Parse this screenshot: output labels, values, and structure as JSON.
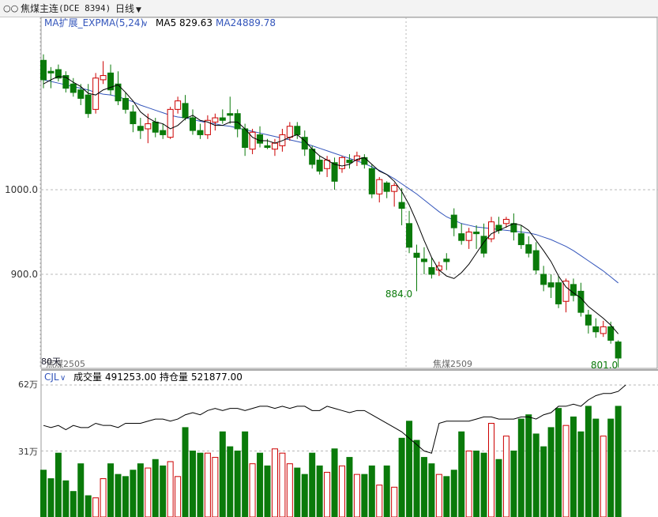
{
  "header": {
    "symbol_icon": "link-icon",
    "symbol_name": "焦煤主连",
    "symbol_code": "(DCE 8394)",
    "period": "日线"
  },
  "main_legend": {
    "indicator": "MA扩展_EXPMA(5,24)",
    "ma5_label": "MA5",
    "ma5_value": "829.63",
    "ma24_label": "MA24",
    "ma24_value": "889.78"
  },
  "vol_legend": {
    "indicator": "CJL",
    "volume_label": "成交量",
    "volume_value": "491253.00",
    "oi_label": "持仓量",
    "oi_value": "521877.00"
  },
  "markers": {
    "low_label": "884.0",
    "last_label": "801.0",
    "contract_a": "焦煤2505",
    "contract_b": "焦煤2509",
    "days_label": "80天"
  },
  "colors": {
    "up": "#cc0000",
    "down": "#0a7a0a",
    "ma5": "#000000",
    "ma24": "#3355bb",
    "grid": "#b8b8b8",
    "oi_line": "#000000"
  },
  "chart_data": [
    {
      "type": "candlestick",
      "title": "焦煤主连(DCE 8394) 日线",
      "y_ticks": [
        1000.0,
        900.0
      ],
      "y_tick_labels": [
        "1000.0",
        "900.0"
      ],
      "ylim": [
        780,
        1180
      ],
      "grid": true,
      "x_labels": [
        {
          "index": 0,
          "text": "焦煤2505"
        },
        {
          "index": 49,
          "text": "焦煤2509"
        }
      ],
      "ohlc": [
        [
          1153,
          1160,
          1120,
          1130
        ],
        [
          1140,
          1145,
          1120,
          1138
        ],
        [
          1142,
          1148,
          1128,
          1132
        ],
        [
          1135,
          1140,
          1115,
          1120
        ],
        [
          1125,
          1132,
          1110,
          1115
        ],
        [
          1118,
          1125,
          1100,
          1108
        ],
        [
          1112,
          1125,
          1085,
          1090
        ],
        [
          1095,
          1138,
          1090,
          1132
        ],
        [
          1130,
          1152,
          1125,
          1135
        ],
        [
          1138,
          1148,
          1112,
          1118
        ],
        [
          1125,
          1140,
          1100,
          1105
        ],
        [
          1108,
          1115,
          1090,
          1095
        ],
        [
          1092,
          1100,
          1068,
          1078
        ],
        [
          1075,
          1085,
          1060,
          1070
        ],
        [
          1072,
          1090,
          1055,
          1078
        ],
        [
          1080,
          1085,
          1062,
          1068
        ],
        [
          1070,
          1078,
          1060,
          1065
        ],
        [
          1062,
          1098,
          1060,
          1095
        ],
        [
          1095,
          1110,
          1090,
          1105
        ],
        [
          1102,
          1112,
          1082,
          1085
        ],
        [
          1085,
          1095,
          1065,
          1070
        ],
        [
          1070,
          1078,
          1060,
          1065
        ],
        [
          1065,
          1088,
          1060,
          1082
        ],
        [
          1080,
          1090,
          1070,
          1085
        ],
        [
          1085,
          1095,
          1078,
          1082
        ],
        [
          1090,
          1110,
          1078,
          1088
        ],
        [
          1090,
          1095,
          1062,
          1072
        ],
        [
          1072,
          1078,
          1040,
          1050
        ],
        [
          1048,
          1072,
          1042,
          1068
        ],
        [
          1065,
          1075,
          1050,
          1055
        ],
        [
          1052,
          1060,
          1048,
          1050
        ],
        [
          1048,
          1060,
          1040,
          1055
        ],
        [
          1052,
          1072,
          1045,
          1065
        ],
        [
          1062,
          1080,
          1058,
          1075
        ],
        [
          1075,
          1080,
          1060,
          1065
        ],
        [
          1062,
          1070,
          1040,
          1048
        ],
        [
          1048,
          1052,
          1025,
          1030
        ],
        [
          1035,
          1040,
          1018,
          1022
        ],
        [
          1025,
          1040,
          1015,
          1035
        ],
        [
          1032,
          1038,
          1000,
          1010
        ],
        [
          1025,
          1040,
          1020,
          1038
        ],
        [
          1035,
          1042,
          1025,
          1032
        ],
        [
          1035,
          1045,
          1028,
          1040
        ],
        [
          1038,
          1042,
          1025,
          1030
        ],
        [
          1025,
          1030,
          990,
          995
        ],
        [
          995,
          1015,
          985,
          1012
        ],
        [
          1008,
          1010,
          990,
          998
        ],
        [
          998,
          1008,
          980,
          1005
        ],
        [
          985,
          1002,
          958,
          978
        ],
        [
          960,
          975,
          925,
          932
        ],
        [
          925,
          935,
          880,
          920
        ],
        [
          918,
          932,
          900,
          915
        ],
        [
          908,
          920,
          895,
          900
        ],
        [
          905,
          915,
          898,
          910
        ],
        [
          918,
          925,
          905,
          915
        ],
        [
          970,
          978,
          945,
          955
        ],
        [
          948,
          960,
          935,
          940
        ],
        [
          940,
          955,
          930,
          950
        ],
        [
          950,
          958,
          930,
          948
        ],
        [
          945,
          960,
          920,
          925
        ],
        [
          942,
          968,
          938,
          962
        ],
        [
          958,
          968,
          948,
          952
        ],
        [
          960,
          968,
          955,
          965
        ],
        [
          960,
          972,
          940,
          950
        ],
        [
          948,
          958,
          930,
          935
        ],
        [
          935,
          945,
          920,
          925
        ],
        [
          928,
          938,
          900,
          905
        ],
        [
          900,
          910,
          880,
          888
        ],
        [
          890,
          900,
          872,
          885
        ],
        [
          890,
          898,
          860,
          865
        ],
        [
          868,
          895,
          855,
          892
        ],
        [
          888,
          895,
          868,
          875
        ],
        [
          880,
          890,
          850,
          855
        ],
        [
          852,
          858,
          830,
          840
        ],
        [
          838,
          848,
          825,
          832
        ],
        [
          830,
          845,
          826,
          838
        ],
        [
          838,
          844,
          818,
          822
        ],
        [
          820,
          822,
          790,
          801
        ]
      ],
      "ma5": [
        1125,
        1130,
        1134,
        1133,
        1127,
        1122,
        1114,
        1112,
        1118,
        1121,
        1124,
        1115,
        1105,
        1092,
        1085,
        1080,
        1078,
        1072,
        1076,
        1084,
        1088,
        1082,
        1080,
        1076,
        1076,
        1080,
        1080,
        1072,
        1062,
        1058,
        1058,
        1055,
        1058,
        1062,
        1065,
        1058,
        1048,
        1040,
        1035,
        1030,
        1028,
        1030,
        1036,
        1038,
        1030,
        1022,
        1018,
        1010,
        998,
        982,
        962,
        940,
        920,
        905,
        898,
        895,
        902,
        912,
        925,
        938,
        948,
        952,
        956,
        960,
        958,
        952,
        940,
        928,
        915,
        898,
        885,
        878,
        872,
        862,
        855,
        848,
        840,
        829.63
      ],
      "ma24": [
        1130,
        1128,
        1126,
        1124,
        1122,
        1120,
        1118,
        1115,
        1113,
        1112,
        1110,
        1107,
        1104,
        1100,
        1097,
        1094,
        1091,
        1088,
        1086,
        1085,
        1083,
        1081,
        1079,
        1078,
        1076,
        1075,
        1073,
        1071,
        1069,
        1067,
        1065,
        1063,
        1061,
        1059,
        1057,
        1055,
        1052,
        1049,
        1046,
        1043,
        1040,
        1037,
        1034,
        1031,
        1027,
        1023,
        1018,
        1013,
        1007,
        1001,
        995,
        988,
        981,
        974,
        968,
        964,
        960,
        958,
        956,
        955,
        954,
        953,
        952,
        951,
        950,
        949,
        947,
        944,
        941,
        937,
        933,
        928,
        922,
        916,
        910,
        904,
        897,
        889.78
      ],
      "annotations": [
        {
          "index": 50,
          "text": "884.0",
          "at": "low"
        },
        {
          "index": 77,
          "text": "801.0",
          "at": "last"
        }
      ]
    },
    {
      "type": "bar",
      "title": "CJL",
      "series": [
        {
          "name": "成交量",
          "values": [
            22,
            18,
            30,
            17,
            12,
            25,
            10,
            9,
            18,
            25,
            20,
            19,
            22,
            25,
            23,
            27,
            24,
            26,
            19,
            42,
            31,
            30,
            30,
            28,
            40,
            33,
            31,
            40,
            25,
            30,
            24,
            32,
            30,
            25,
            23,
            20,
            30,
            24,
            21,
            32,
            24,
            28,
            20,
            20,
            24,
            15,
            24,
            14,
            37,
            45,
            36,
            28,
            25,
            20,
            19,
            22,
            40,
            31,
            31,
            30,
            44,
            27,
            38,
            31,
            46,
            48,
            39,
            33,
            42,
            51,
            43,
            47,
            40,
            52,
            46,
            38,
            46,
            52
          ]
        }
      ],
      "series_b": {
        "name": "持仓量",
        "values": [
          43,
          42,
          43,
          41,
          43,
          42,
          42,
          44,
          43,
          43,
          42,
          44,
          44,
          44,
          45,
          46,
          46,
          45,
          46,
          48,
          49,
          48,
          50,
          51,
          50,
          51,
          51,
          50,
          51,
          52,
          52,
          51,
          52,
          51,
          52,
          52,
          50,
          50,
          52,
          51,
          50,
          49,
          50,
          50,
          48,
          46,
          44,
          42,
          40,
          37,
          34,
          31,
          30,
          44,
          45,
          45,
          45,
          45,
          46,
          47,
          47,
          46,
          46,
          46,
          47,
          47,
          46,
          48,
          49,
          52,
          52,
          53,
          52,
          55,
          57,
          58,
          58,
          59,
          62
        ]
      },
      "y_ticks": [
        62,
        31
      ],
      "y_tick_labels": [
        "62万",
        "31万"
      ],
      "ylim": [
        0,
        64
      ]
    }
  ]
}
